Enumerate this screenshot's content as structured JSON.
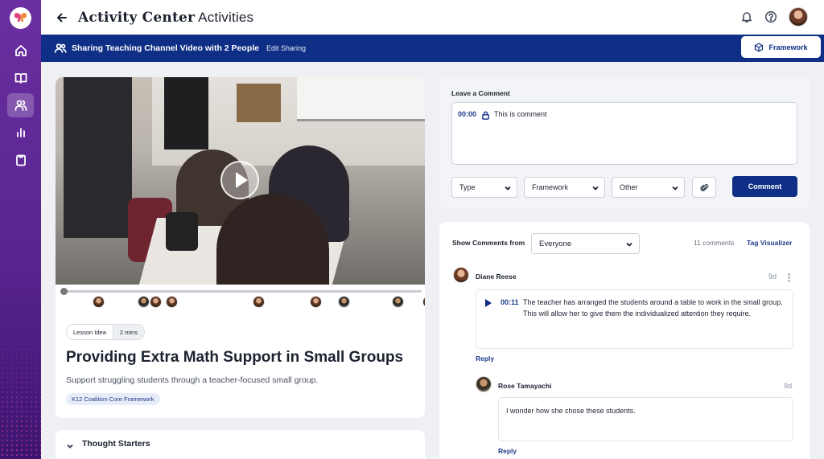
{
  "header": {
    "title_bold": "Activity Center",
    "title_rest": "Activities"
  },
  "banner": {
    "text": "Sharing Teaching Channel Video with 2 People",
    "edit_label": "Edit Sharing",
    "framework_button": "Framework"
  },
  "video": {
    "progress": 0.0,
    "markers": 10
  },
  "lesson": {
    "type": "Lesson Idea",
    "duration": "2 mins",
    "title": "Providing Extra Math Support in Small Groups",
    "description": "Support struggling students through a teacher-focused small group.",
    "framework_tag": "K12 Coalition Core Framework",
    "thought_starters": "Thought Starters"
  },
  "comment_form": {
    "label": "Leave a Comment",
    "timestamp": "00:00",
    "text": "This is comment",
    "type_select": "Type",
    "framework_select": "Framework",
    "other_select": "Other",
    "submit": "Comment"
  },
  "comments_panel": {
    "show_label": "Show Comments from",
    "filter_value": "Everyone",
    "count": "11 comments",
    "tag_visualizer": "Tag Visualizer",
    "comments": [
      {
        "author": "Diane Reese",
        "ago": "9d",
        "timestamp": "00:11",
        "text": "The teacher has arranged the students around a table to work in the small group. This will allow her to give them the individualized attention they require.",
        "reply": "Reply"
      },
      {
        "author": "Rose Tamayachi",
        "ago": "9d",
        "text": "I wonder how she chose these students.",
        "reply": "Reply"
      }
    ]
  },
  "icons": {
    "logo": "butterfly-logo",
    "nav": [
      "home-icon",
      "book-icon",
      "users-icon",
      "chart-icon",
      "clipboard-icon"
    ],
    "bell": "bell-icon",
    "help": "help-icon"
  },
  "colors": {
    "rail": "#5a2590",
    "primary": "#0f2f86",
    "link": "#1e3a8a"
  }
}
